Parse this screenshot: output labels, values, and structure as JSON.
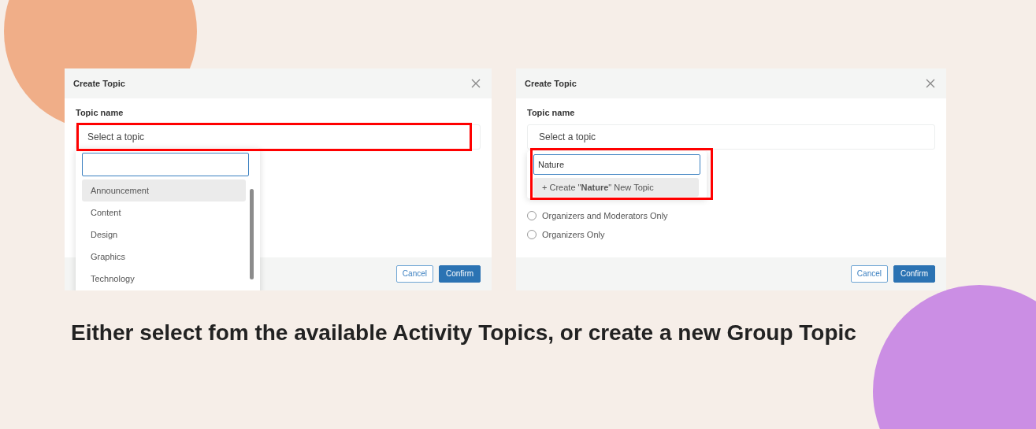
{
  "panels": [
    {
      "title": "Create Topic",
      "field_label": "Topic name",
      "select": {
        "placeholder": "Select a topic",
        "highlighted": true
      },
      "dropdown": {
        "highlighted": false,
        "options": [
          {
            "kind": "topic",
            "label": "Announcement",
            "selected": true
          },
          {
            "kind": "topic",
            "label": "Content",
            "selected": false
          },
          {
            "kind": "topic",
            "label": "Design",
            "selected": false
          },
          {
            "kind": "topic",
            "label": "Graphics",
            "selected": false
          },
          {
            "kind": "topic",
            "label": "Technology",
            "selected": false
          }
        ]
      },
      "buttons": [
        {
          "label": "Cancel",
          "kind": "secondary"
        },
        {
          "label": "Confirm",
          "kind": "primary"
        }
      ]
    },
    {
      "title": "Create Topic",
      "field_label": "Topic name",
      "select": {
        "placeholder": "Select a topic",
        "highlighted": false
      },
      "dropdown": {
        "highlighted": true,
        "search_value": "Nature",
        "options": [
          {
            "kind": "create",
            "label": "+ Create \"**Nature**\" New Topic",
            "selected": true
          }
        ]
      },
      "radios": [
        {
          "label": "Organizers and Moderators Only",
          "checked": false
        },
        {
          "label": "Organizers Only",
          "checked": false
        }
      ],
      "buttons": [
        {
          "label": "Cancel",
          "kind": "secondary"
        },
        {
          "label": "Confirm",
          "kind": "primary"
        }
      ]
    }
  ],
  "caption": "Either select fom the available Activity Topics, or create a new Group Topic"
}
